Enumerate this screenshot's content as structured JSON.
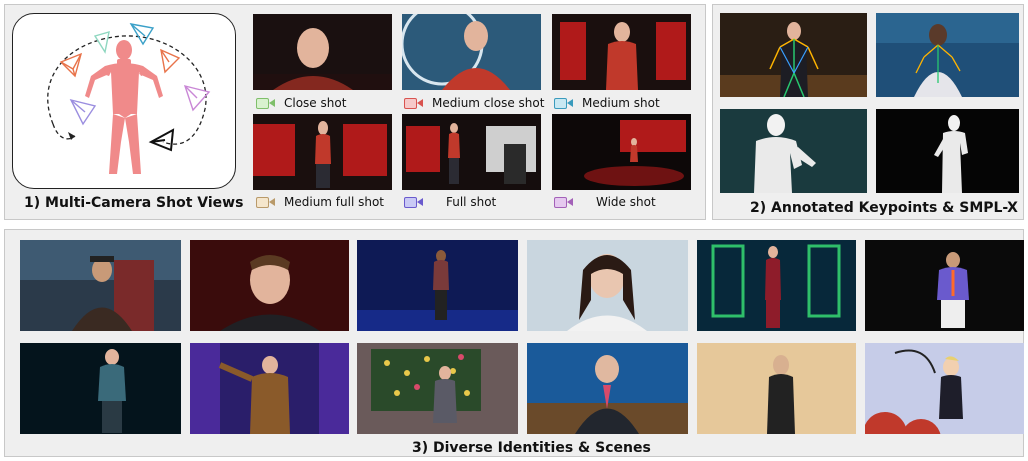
{
  "section1": {
    "caption": "1) Multi-Camera Shot Views",
    "shots": [
      {
        "label": "Close shot",
        "icon": "camera-icon",
        "fill": "#d9f2cf",
        "stroke": "#7fbf6a"
      },
      {
        "label": "Medium close shot",
        "icon": "camera-icon",
        "fill": "#f6c9c9",
        "stroke": "#d9534f"
      },
      {
        "label": "Medium shot",
        "icon": "camera-icon",
        "fill": "#c8e8f2",
        "stroke": "#3a9bbd"
      },
      {
        "label": "Medium full shot",
        "icon": "camera-icon",
        "fill": "#f5e6cc",
        "stroke": "#b99a6a"
      },
      {
        "label": "Full shot",
        "icon": "camera-icon",
        "fill": "#c9c9f5",
        "stroke": "#6a5acd"
      },
      {
        "label": "Wide shot",
        "icon": "camera-icon",
        "fill": "#e5c9ef",
        "stroke": "#a361b8"
      }
    ]
  },
  "section2": {
    "caption": "2) Annotated Keypoints & SMPL-X"
  },
  "section3": {
    "caption": "3) Diverse Identities & Scenes"
  },
  "colors": {
    "panel_bg": "#efefef",
    "figure_pink": "#f08a8a",
    "stage_red": "#c0392b"
  }
}
